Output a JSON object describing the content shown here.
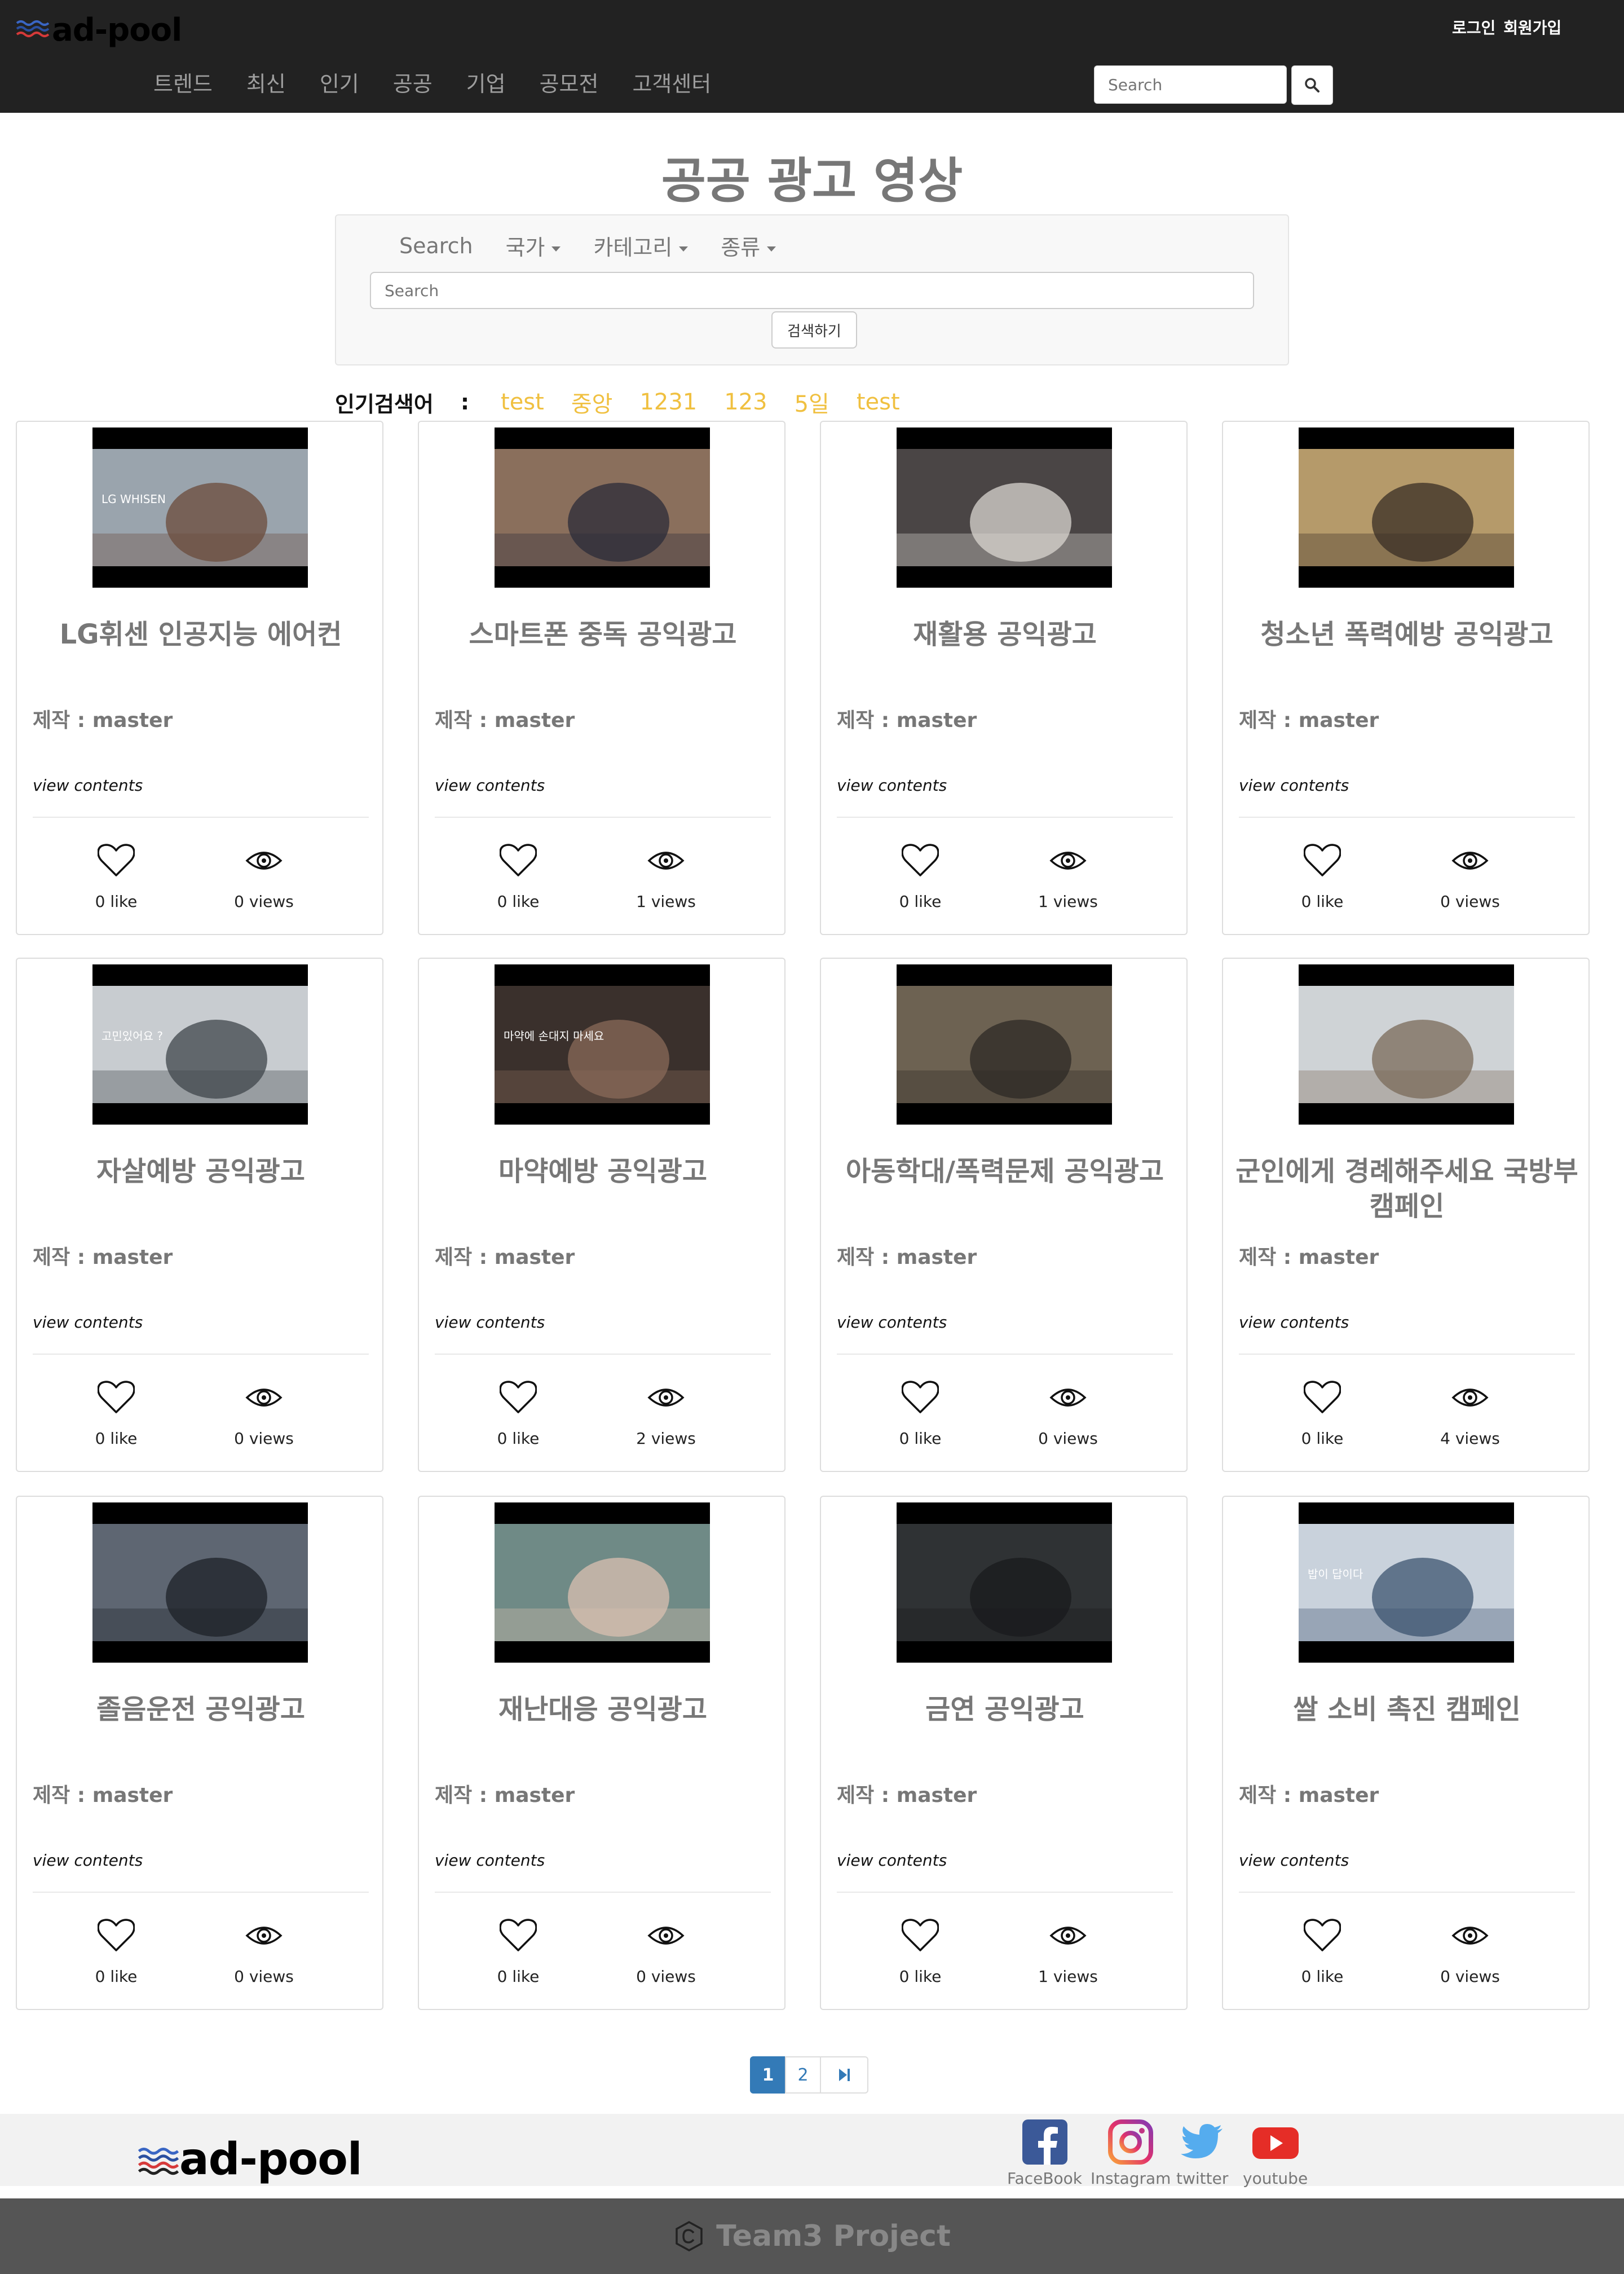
{
  "header": {
    "brand": "ad-pool",
    "auth": [
      "로그인",
      "회원가입"
    ],
    "nav": [
      "트렌드",
      "최신",
      "인기",
      "공공",
      "기업",
      "공모전",
      "고객센터"
    ],
    "search_placeholder": "Search"
  },
  "page_title": "공공 광고 영상",
  "search_panel": {
    "search_label": "Search",
    "filters": [
      "국가",
      "카테고리",
      "종류"
    ],
    "input_placeholder": "Search",
    "button_label": "검색하기"
  },
  "popular": {
    "label": "인기검색어",
    "colon": ":",
    "keywords": [
      "test",
      "중앙",
      "1231",
      "123",
      "5일",
      "test"
    ]
  },
  "cards": [
    {
      "title": "LG휘센 인공지능 에어컨",
      "author": "제작 : master",
      "view": "view contents",
      "likes": "0 like",
      "views": "0 views",
      "thumb": {
        "bg": "#9aa4ad",
        "accent": "#6b4b3b",
        "overlay": "LG WHISEN"
      }
    },
    {
      "title": "스마트폰 중독 공익광고",
      "author": "제작 : master",
      "view": "view contents",
      "likes": "0 like",
      "views": "1 views",
      "thumb": {
        "bg": "#8a6f5c",
        "accent": "#2b2b38",
        "overlay": ""
      }
    },
    {
      "title": "재활용 공익광고",
      "author": "제작 : master",
      "view": "view contents",
      "likes": "0 like",
      "views": "1 views",
      "thumb": {
        "bg": "#4a4545",
        "accent": "#d9d6d0",
        "overlay": ""
      }
    },
    {
      "title": "청소년 폭력예방 공익광고",
      "author": "제작 : master",
      "view": "view contents",
      "likes": "0 like",
      "views": "0 views",
      "thumb": {
        "bg": "#b59a6a",
        "accent": "#3a2e26",
        "overlay": ""
      }
    },
    {
      "title": "자살예방 공익광고",
      "author": "제작 : master",
      "view": "view contents",
      "likes": "0 like",
      "views": "0 views",
      "thumb": {
        "bg": "#c8ccd0",
        "accent": "#3f454b",
        "overlay": "고민있어요 ?"
      }
    },
    {
      "title": "마약예방 공익광고",
      "author": "제작 : master",
      "view": "view contents",
      "likes": "0 like",
      "views": "2 views",
      "thumb": {
        "bg": "#3a302c",
        "accent": "#8a6a58",
        "overlay": "마약에 손대지 마세요"
      }
    },
    {
      "title": "아동학대/폭력문제 공익광고",
      "author": "제작 : master",
      "view": "view contents",
      "likes": "0 like",
      "views": "0 views",
      "thumb": {
        "bg": "#6d6252",
        "accent": "#2e2a26",
        "overlay": ""
      }
    },
    {
      "title": "군인에게 경례해주세요 국방부 캠페인",
      "author": "제작 : master",
      "view": "view contents",
      "likes": "0 like",
      "views": "4 views",
      "thumb": {
        "bg": "#cfd3d6",
        "accent": "#7a6a58",
        "overlay": ""
      }
    },
    {
      "title": "졸음운전 공익광고",
      "author": "제작 : master",
      "view": "view contents",
      "likes": "0 like",
      "views": "0 views",
      "thumb": {
        "bg": "#5e6672",
        "accent": "#1e2128",
        "overlay": ""
      }
    },
    {
      "title": "재난대응 공익광고",
      "author": "제작 : master",
      "view": "view contents",
      "likes": "0 like",
      "views": "0 views",
      "thumb": {
        "bg": "#6f8a86",
        "accent": "#d9bfb0",
        "overlay": ""
      }
    },
    {
      "title": "금연 공익광고",
      "author": "제작 : master",
      "view": "view contents",
      "likes": "0 like",
      "views": "1 views",
      "thumb": {
        "bg": "#2f3234",
        "accent": "#1a1b1c",
        "overlay": ""
      }
    },
    {
      "title": "쌀 소비 촉진 캠페인",
      "author": "제작 : master",
      "view": "view contents",
      "likes": "0 like",
      "views": "0 views",
      "thumb": {
        "bg": "#c9d2dc",
        "accent": "#3c5470",
        "overlay": "밥이 답이다"
      }
    }
  ],
  "pagination": {
    "pages": [
      "1",
      "2"
    ],
    "last": "▶|"
  },
  "footer": {
    "brand": "ad-pool",
    "social": [
      {
        "name": "FaceBook",
        "icon": "facebook-icon",
        "color": "#3b5998"
      },
      {
        "name": "Instagram",
        "icon": "instagram-icon",
        "color": "#c13584"
      },
      {
        "name": "twitter",
        "icon": "twitter-icon",
        "color": "#55acee"
      },
      {
        "name": "youtube",
        "icon": "youtube-icon",
        "color": "#e52d27"
      }
    ],
    "copyright": "Team3 Project"
  }
}
